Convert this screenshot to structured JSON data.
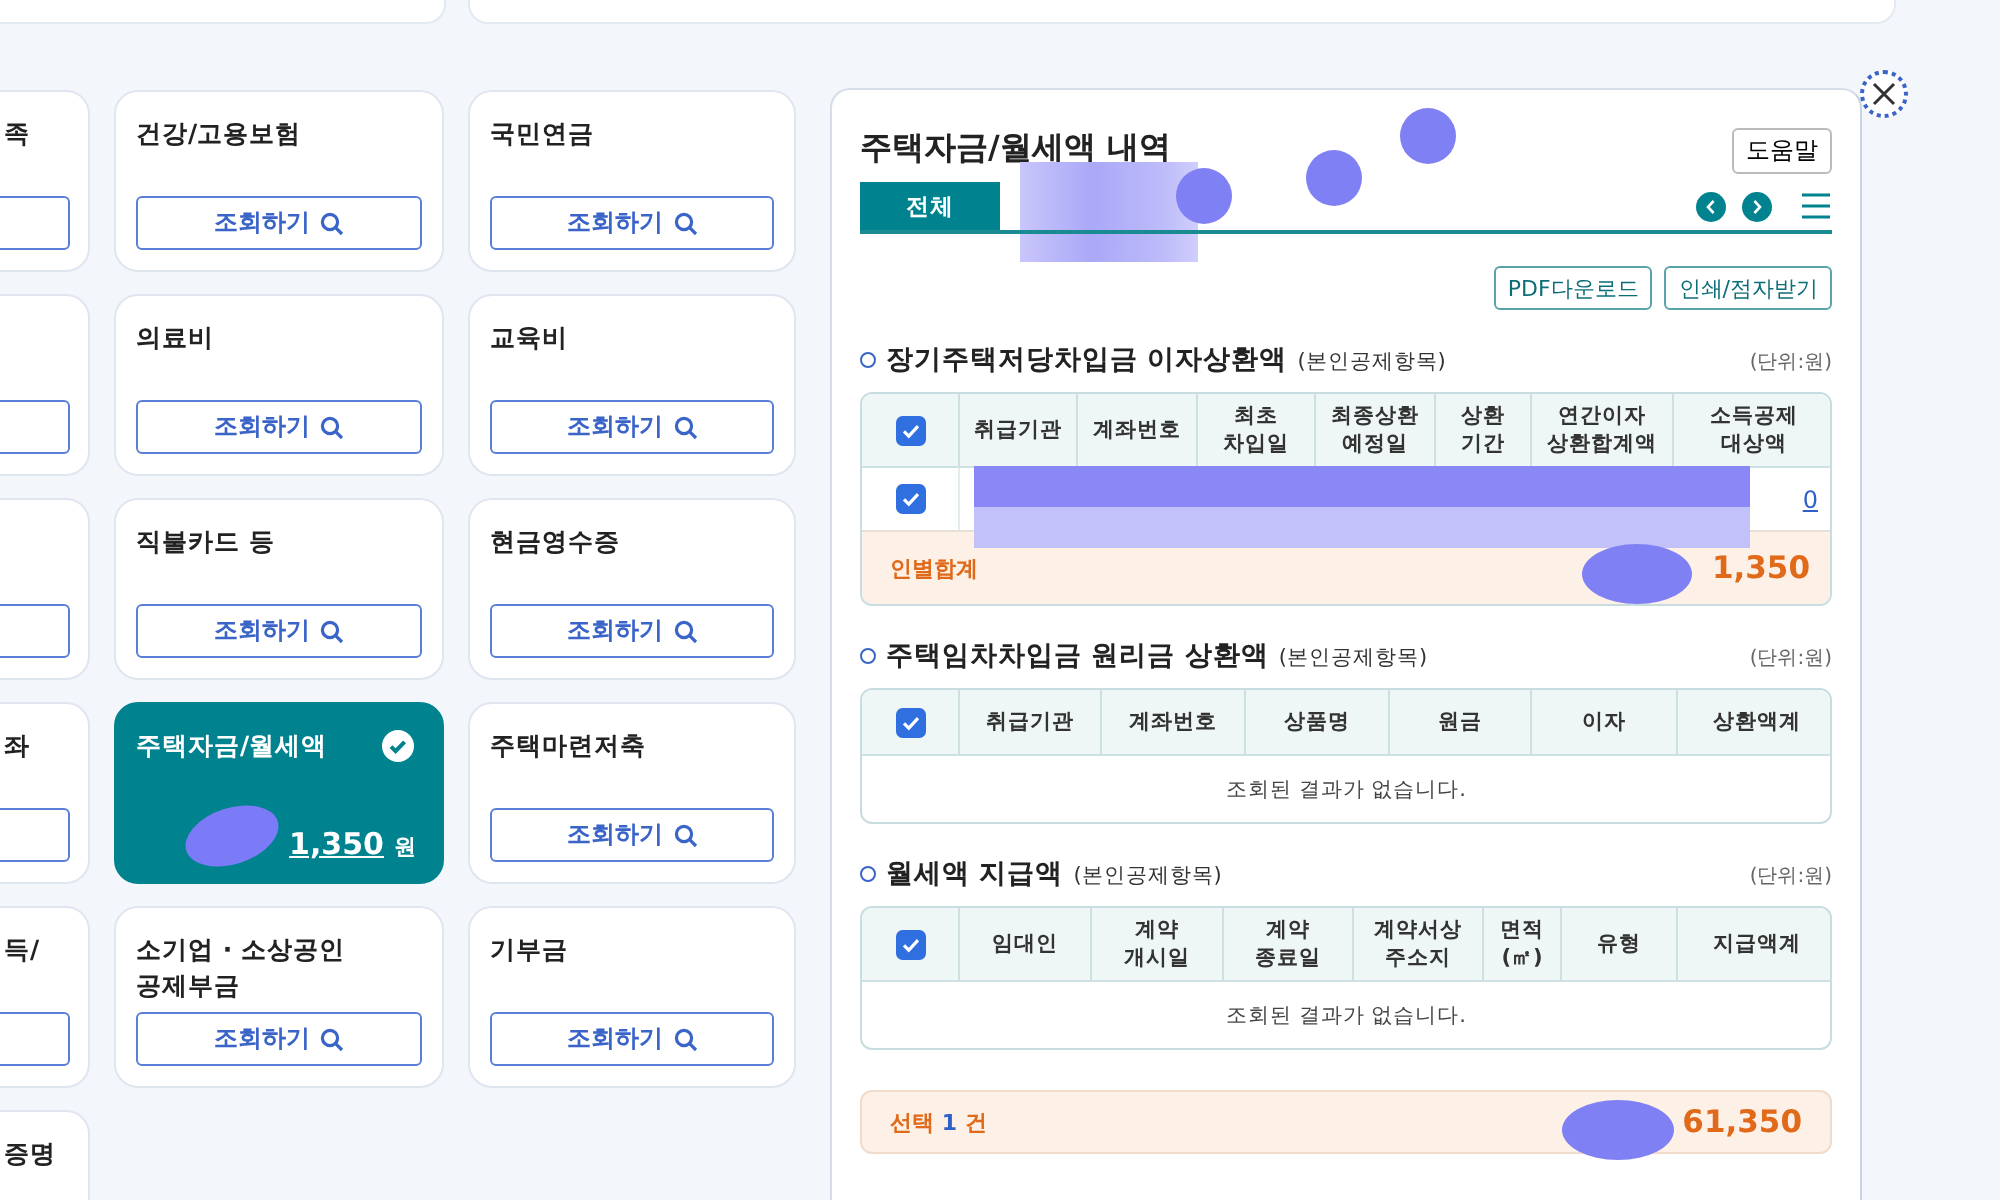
{
  "cards": [
    {
      "kind": "cut",
      "title": "족",
      "button": true
    },
    {
      "kind": "query",
      "title": "건강/고용보험",
      "button": "조회하기",
      "selected": false
    },
    {
      "kind": "query",
      "title": "국민연금",
      "button": "조회하기",
      "selected": false
    },
    {
      "kind": "cut",
      "button": true
    },
    {
      "kind": "query",
      "title": "의료비",
      "button": "조회하기",
      "selected": false
    },
    {
      "kind": "query",
      "title": "교육비",
      "button": "조회하기",
      "selected": false
    },
    {
      "kind": "cut",
      "button": true
    },
    {
      "kind": "query",
      "title": "직불카드 등",
      "button": "조회하기",
      "selected": false
    },
    {
      "kind": "query",
      "title": "현금영수증",
      "button": "조회하기",
      "selected": false
    },
    {
      "kind": "cut",
      "title": "좌",
      "button": true
    },
    {
      "kind": "amount",
      "title": "주택자금/월세액",
      "amount": "1,350",
      "unit": "원",
      "selected": true
    },
    {
      "kind": "query",
      "title": "주택마련저축",
      "button": "조회하기",
      "selected": false
    },
    {
      "kind": "cut",
      "title": "득/",
      "button": true
    },
    {
      "kind": "query",
      "title": "소기업 · 소상공인\n공제부금",
      "button": "조회하기",
      "selected": false
    },
    {
      "kind": "query",
      "title": "기부금",
      "button": "조회하기",
      "selected": false
    },
    {
      "kind": "cut",
      "title": "증명",
      "button": false
    }
  ],
  "detail": {
    "title": "주택자금/월세액 내역",
    "help_button": "도움말",
    "tabs": [
      {
        "label": "전체",
        "selected": true
      }
    ],
    "actions": [
      "PDF다운로드",
      "인쇄/점자받기"
    ],
    "sections": [
      {
        "title": "장기주택저당차입금 이자상환액",
        "note": "(본인공제항목)",
        "unit": "(단위:원)",
        "all_checked": true,
        "columns": [
          "취급기관",
          "계좌번호",
          "최초\n차입일",
          "최종상환\n예정일",
          "상환\n기간",
          "연간이자\n상환합계액",
          "소득공제\n대상액"
        ],
        "rows": [
          {
            "checked": true,
            "amount": "0"
          }
        ],
        "total": {
          "label": "인별합계",
          "value": "1,350"
        }
      },
      {
        "title": "주택임차차입금 원리금 상환액",
        "note": "(본인공제항목)",
        "unit": "(단위:원)",
        "all_checked": true,
        "columns": [
          "취급기관",
          "계좌번호",
          "상품명",
          "원금",
          "이자",
          "상환액계"
        ],
        "empty_message": "조회된 결과가 없습니다."
      },
      {
        "title": "월세액 지급액",
        "note": "(본인공제항목)",
        "unit": "(단위:원)",
        "all_checked": true,
        "columns": [
          "임대인",
          "계약\n개시일",
          "계약\n종료일",
          "계약서상\n주소지",
          "면적\n(㎡)",
          "유형",
          "지급액계"
        ],
        "empty_message": "조회된 결과가 없습니다."
      }
    ],
    "footer": {
      "prefix": "선택",
      "count": "1",
      "suffix": "건",
      "total": "61,350"
    }
  }
}
